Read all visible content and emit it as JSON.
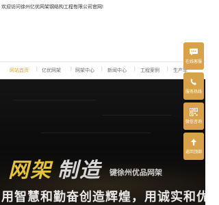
{
  "topbar": {
    "welcome": "欢迎访问徐州亿优网架钢结构工程有限公司官网!"
  },
  "nav": {
    "items": [
      {
        "label": "网站首页",
        "active": true
      },
      {
        "label": "亿优网架",
        "active": false
      },
      {
        "label": "网架中心",
        "active": false
      },
      {
        "label": "新闻中心",
        "active": false
      },
      {
        "label": "工程案例",
        "active": false
      },
      {
        "label": "生产车",
        "active": false
      }
    ]
  },
  "banner": {
    "big_left": "网架",
    "big_right": "制造",
    "slogan": "键徐州优品网架",
    "sub": "用智慧和勤奋创造辉煌，用诚实和优质赢得客户"
  },
  "sidebar": {
    "items": [
      {
        "label": "在线客服",
        "icon": "chat-icon"
      },
      {
        "label": "服务热线",
        "icon": "phone-icon"
      },
      {
        "label": "微信咨询",
        "icon": "qrcode-icon"
      },
      {
        "label": "返回顶部",
        "icon": "arrow-up-icon"
      }
    ]
  },
  "colors": {
    "accent": "#d8a24a",
    "nav_active": "#d9a441"
  }
}
